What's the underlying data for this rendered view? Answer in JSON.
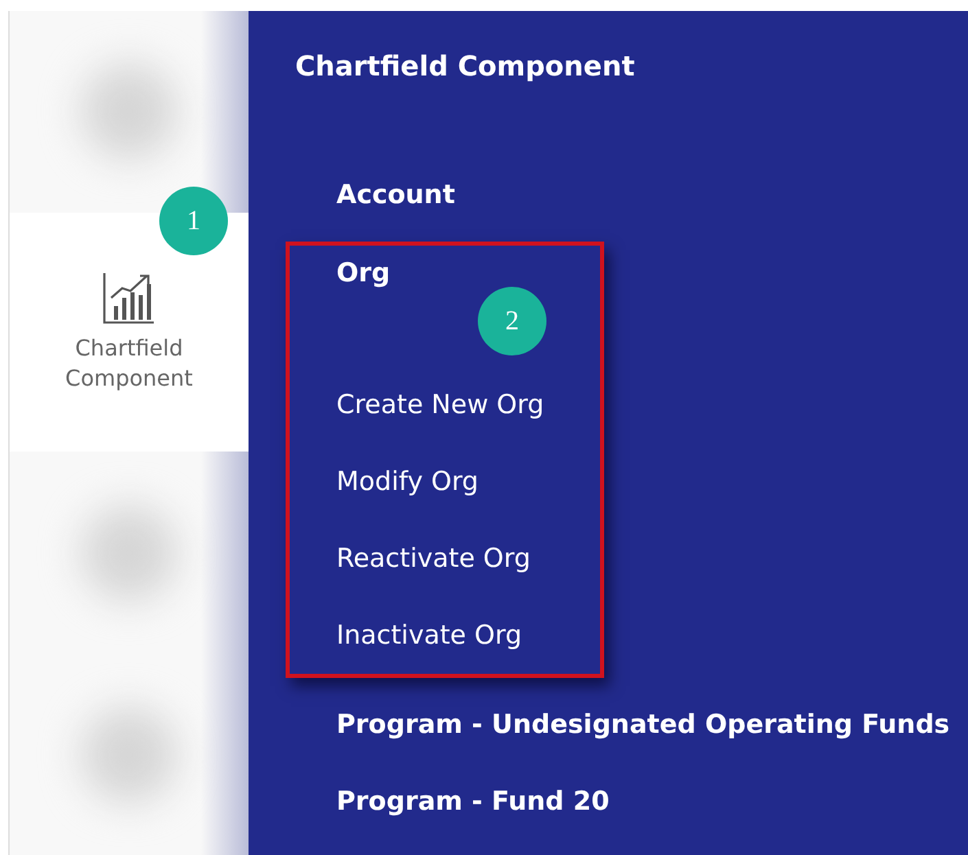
{
  "sidebar": {
    "items": [
      {
        "label": "Chartfield Component",
        "selected": true
      }
    ]
  },
  "panel": {
    "title": "Chartfield Component",
    "items": [
      {
        "kind": "heading",
        "label": "Account"
      },
      {
        "kind": "heading",
        "label": "Org",
        "expanded": true,
        "highlighted": true,
        "children": [
          {
            "kind": "action",
            "label": "Create New Org"
          },
          {
            "kind": "action",
            "label": "Modify Org"
          },
          {
            "kind": "action",
            "label": "Reactivate Org"
          },
          {
            "kind": "action",
            "label": "Inactivate Org"
          }
        ]
      },
      {
        "kind": "heading",
        "label": "Program - Undesignated Operating Funds"
      },
      {
        "kind": "heading",
        "label": "Program - Fund 20"
      }
    ]
  },
  "callouts": [
    {
      "label": "1"
    },
    {
      "label": "2"
    }
  ]
}
